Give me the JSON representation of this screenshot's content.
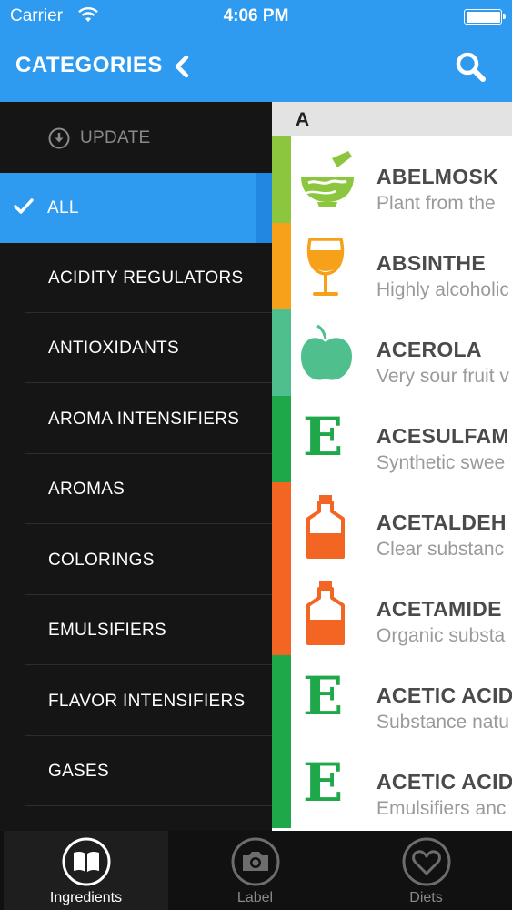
{
  "status_bar": {
    "carrier": "Carrier",
    "time": "4:06 PM"
  },
  "header": {
    "title": "CATEGORIES",
    "back_icon": "chevron-left-icon",
    "search_icon": "search-icon"
  },
  "sidebar": {
    "update_label": "UPDATE",
    "items": [
      {
        "label": "ALL",
        "selected": true
      },
      {
        "label": "ACIDITY REGULATORS"
      },
      {
        "label": "ANTIOXIDANTS"
      },
      {
        "label": "AROMA INTENSIFIERS"
      },
      {
        "label": "AROMAS"
      },
      {
        "label": "COLORINGS"
      },
      {
        "label": "EMULSIFIERS"
      },
      {
        "label": "FLAVOR INTENSIFIERS"
      },
      {
        "label": "GASES"
      }
    ]
  },
  "list": {
    "section": "A",
    "items": [
      {
        "name": "ABELMOSK",
        "desc": "Plant from the",
        "color": "#8cc63f",
        "icon": "mortar-pestle-icon"
      },
      {
        "name": "ABSINTHE",
        "desc": "Highly alcoholic",
        "color": "#f7a11a",
        "icon": "wine-glass-icon"
      },
      {
        "name": "ACEROLA",
        "desc": "Very sour fruit v",
        "color": "#4fc08d",
        "icon": "apple-icon"
      },
      {
        "name": "ACESULFAM",
        "desc": "Synthetic swee",
        "color": "#1ea84a",
        "icon": "e-number-icon"
      },
      {
        "name": "ACETALDEH",
        "desc": "Clear substanc",
        "color": "#f26522",
        "icon": "bottle-icon"
      },
      {
        "name": "ACETAMIDE",
        "desc": "Organic substa",
        "color": "#f26522",
        "icon": "bottle-icon"
      },
      {
        "name": "ACETIC ACID",
        "desc": "Substance natu",
        "color": "#1ea84a",
        "icon": "e-number-icon"
      },
      {
        "name": "ACETIC ACID",
        "desc": "Emulsifiers anc",
        "color": "#1ea84a",
        "icon": "e-number-icon"
      }
    ]
  },
  "tabbar": {
    "tabs": [
      {
        "label": "Ingredients",
        "icon": "book-icon",
        "active": true
      },
      {
        "label": "Label",
        "icon": "camera-icon"
      },
      {
        "label": "Diets",
        "icon": "heart-icon"
      }
    ]
  },
  "colors": {
    "accent": "#2e9bf0",
    "sidebar_bg": "#151515",
    "tab_bg": "#111111"
  }
}
